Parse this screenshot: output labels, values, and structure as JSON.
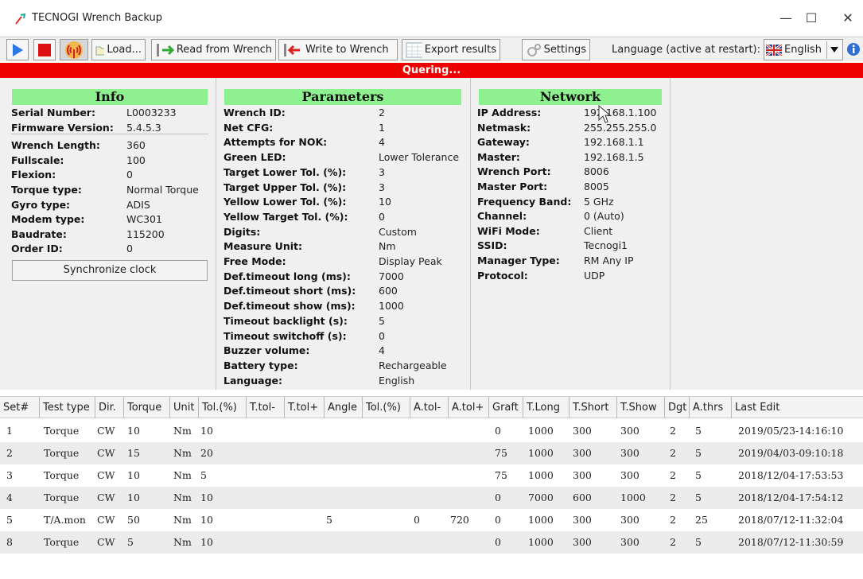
{
  "window": {
    "title": "TECNOGI Wrench Backup",
    "minimize": "—",
    "maximize": "☐",
    "close": "✕"
  },
  "toolbar": {
    "load": "Load...",
    "read": "Read from Wrench",
    "write": "Write to Wrench",
    "export": "Export results",
    "settings": "Settings",
    "language_label": "Language (active at restart):",
    "language_value": "English"
  },
  "status": "Quering...",
  "info": {
    "title": "Info",
    "rows": [
      {
        "k": "Serial Number:",
        "v": "L0003233"
      },
      {
        "k": "Firmware Version:",
        "v": "5.4.5.3"
      },
      {
        "k": "Wrench Length:",
        "v": "360"
      },
      {
        "k": "Fullscale:",
        "v": "100"
      },
      {
        "k": "Flexion:",
        "v": "0"
      },
      {
        "k": "Torque type:",
        "v": "Normal Torque"
      },
      {
        "k": "Gyro type:",
        "v": "ADIS"
      },
      {
        "k": "Modem type:",
        "v": "WC301"
      },
      {
        "k": "Baudrate:",
        "v": "115200"
      },
      {
        "k": "Order ID:",
        "v": "0"
      }
    ],
    "sync_button": "Synchronize clock"
  },
  "parameters": {
    "title": "Parameters",
    "rows": [
      {
        "k": "Wrench ID:",
        "v": "2"
      },
      {
        "k": "Net CFG:",
        "v": "1"
      },
      {
        "k": "Attempts for NOK:",
        "v": "4"
      },
      {
        "k": "Green LED:",
        "v": "Lower Tolerance"
      },
      {
        "k": "Target Lower Tol. (%):",
        "v": "3"
      },
      {
        "k": "Target Upper Tol. (%):",
        "v": "3"
      },
      {
        "k": "Yellow Lower Tol. (%):",
        "v": "10"
      },
      {
        "k": "Yellow Target Tol. (%):",
        "v": "0"
      },
      {
        "k": "Digits:",
        "v": "Custom"
      },
      {
        "k": "Measure Unit:",
        "v": "Nm"
      },
      {
        "k": "Free Mode:",
        "v": "Display Peak"
      },
      {
        "k": "Def.timeout long (ms):",
        "v": "7000"
      },
      {
        "k": "Def.timeout short (ms):",
        "v": "600"
      },
      {
        "k": "Def.timeout show (ms):",
        "v": "1000"
      },
      {
        "k": "Timeout backlight (s):",
        "v": "5"
      },
      {
        "k": "Timeout switchoff (s):",
        "v": "0"
      },
      {
        "k": "Buzzer volume:",
        "v": "4"
      },
      {
        "k": "Battery type:",
        "v": "Rechargeable"
      },
      {
        "k": "Language:",
        "v": "English"
      }
    ]
  },
  "network": {
    "title": "Network",
    "rows": [
      {
        "k": "IP Address:",
        "v": "192.168.1.100"
      },
      {
        "k": "Netmask:",
        "v": "255.255.255.0"
      },
      {
        "k": "Gateway:",
        "v": "192.168.1.1"
      },
      {
        "k": "Master:",
        "v": "192.168.1.5"
      },
      {
        "k": "Wrench Port:",
        "v": "8006"
      },
      {
        "k": "Master Port:",
        "v": "8005"
      },
      {
        "k": "Frequency Band:",
        "v": "5 GHz"
      },
      {
        "k": "Channel:",
        "v": "0 (Auto)"
      },
      {
        "k": "WiFi Mode:",
        "v": "Client"
      },
      {
        "k": "SSID:",
        "v": "Tecnogi1"
      },
      {
        "k": "Manager Type:",
        "v": "RM Any IP"
      },
      {
        "k": "Protocol:",
        "v": "UDP"
      }
    ]
  },
  "table": {
    "columns": [
      "Set#",
      "Test type",
      "Dir.",
      "Torque",
      "Unit",
      "Tol.(%)",
      "T.tol-",
      "T.tol+",
      "Angle",
      "Tol.(%)",
      "A.tol-",
      "A.tol+",
      "Graft",
      "T.Long",
      "T.Short",
      "T.Show",
      "Dgt",
      "A.thrs",
      "Last Edit"
    ],
    "rows": [
      [
        "1",
        "Torque",
        "CW",
        "10",
        "Nm",
        "10",
        "",
        "",
        "",
        "",
        "",
        "",
        "0",
        "1000",
        "300",
        "300",
        "2",
        "5",
        "2019/05/23-14:16:10"
      ],
      [
        "2",
        "Torque",
        "CW",
        "15",
        "Nm",
        "20",
        "",
        "",
        "",
        "",
        "",
        "",
        "75",
        "1000",
        "300",
        "300",
        "2",
        "5",
        "2019/04/03-09:10:18"
      ],
      [
        "3",
        "Torque",
        "CW",
        "10",
        "Nm",
        "5",
        "",
        "",
        "",
        "",
        "",
        "",
        "75",
        "1000",
        "300",
        "300",
        "2",
        "5",
        "2018/12/04-17:53:53"
      ],
      [
        "4",
        "Torque",
        "CW",
        "10",
        "Nm",
        "10",
        "",
        "",
        "",
        "",
        "",
        "",
        "0",
        "7000",
        "600",
        "1000",
        "2",
        "5",
        "2018/12/04-17:54:12"
      ],
      [
        "5",
        "T/A.mon",
        "CW",
        "50",
        "Nm",
        "10",
        "",
        "",
        "5",
        "",
        "0",
        "720",
        "0",
        "1000",
        "300",
        "300",
        "2",
        "25",
        "2018/07/12-11:32:04"
      ],
      [
        "8",
        "Torque",
        "CW",
        "5",
        "Nm",
        "10",
        "",
        "",
        "",
        "",
        "",
        "",
        "0",
        "1000",
        "300",
        "300",
        "2",
        "5",
        "2018/07/12-11:30:59"
      ]
    ]
  }
}
